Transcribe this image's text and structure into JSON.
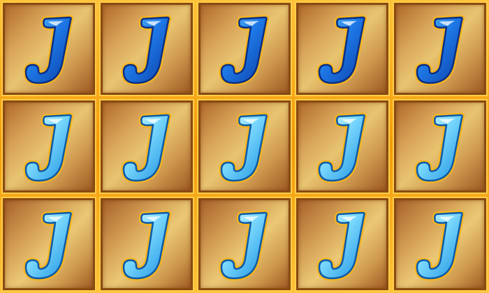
{
  "game": {
    "symbol_letter": "J",
    "grid": [
      [
        "J",
        "J",
        "J",
        "J",
        "J"
      ],
      [
        "J",
        "J",
        "J",
        "J",
        "J"
      ],
      [
        "J",
        "J",
        "J",
        "J",
        "J"
      ]
    ]
  },
  "colors": {
    "frame_gold": "#f5a20a",
    "tile_border": "#8a4a10",
    "letter_dark_blue": "#1257c8",
    "letter_light_blue": "#6fd6ff",
    "letter_outline_gold": "#f7b51c"
  }
}
